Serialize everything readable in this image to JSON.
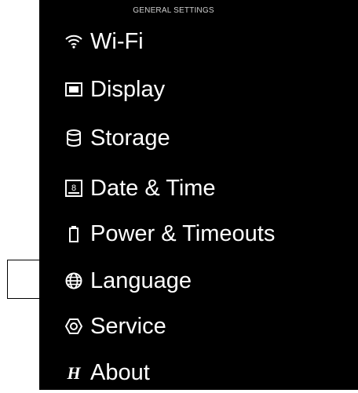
{
  "header": {
    "title": "GENERAL SETTINGS"
  },
  "menu": {
    "items": [
      {
        "label": "Wi-Fi",
        "icon": "wifi-icon"
      },
      {
        "label": "Display",
        "icon": "display-icon"
      },
      {
        "label": "Storage",
        "icon": "storage-icon"
      },
      {
        "label": "Date & Time",
        "icon": "calendar-icon",
        "icon_text": "8"
      },
      {
        "label": "Power & Timeouts",
        "icon": "battery-icon"
      },
      {
        "label": "Language",
        "icon": "globe-icon",
        "selected": true
      },
      {
        "label": "Service",
        "icon": "service-icon"
      },
      {
        "label": "About",
        "icon": "brand-logo-icon",
        "icon_text": "H"
      }
    ]
  },
  "colors": {
    "background": "#000000",
    "text": "#ffffff",
    "header_text": "#cfcfcf",
    "page": "#ffffff",
    "selection_frame": "#000000"
  }
}
